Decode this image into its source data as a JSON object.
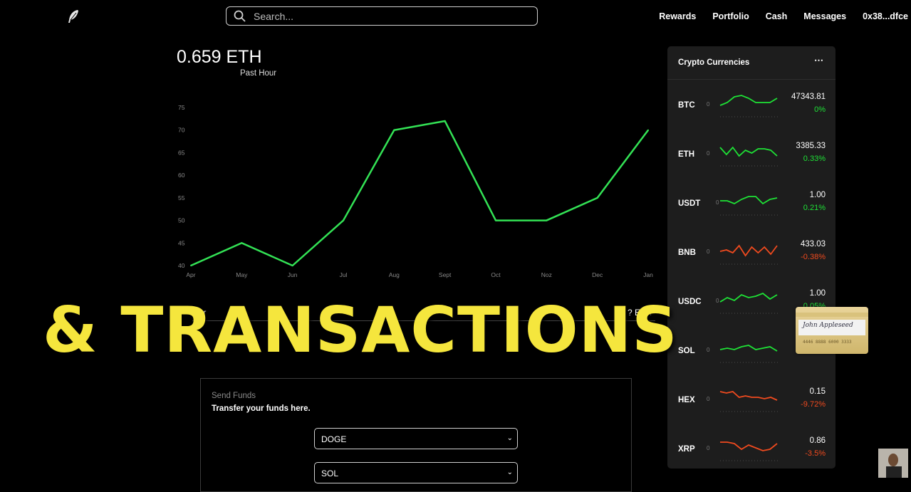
{
  "header": {
    "search_placeholder": "Search...",
    "nav": [
      "Rewards",
      "Portfolio",
      "Cash",
      "Messages",
      "0x38...dfce"
    ]
  },
  "balance": {
    "amount": "0.659 ETH",
    "period": "Past Hour"
  },
  "chart_data": {
    "type": "line",
    "categories": [
      "Apr",
      "May",
      "Jun",
      "Jul",
      "Aug",
      "Sept",
      "Oct",
      "Noz",
      "Dec",
      "Jan"
    ],
    "values": [
      40,
      45,
      40,
      50,
      70,
      72,
      50,
      50,
      55,
      70
    ],
    "yticks": [
      40,
      45,
      50,
      55,
      60,
      65,
      70,
      75
    ],
    "ylim": [
      40,
      75
    ],
    "color": "#33e255",
    "grid": false
  },
  "buy_row": {
    "left": "wer",
    "right": "? ETH"
  },
  "send_funds": {
    "title": "Send Funds",
    "subtitle": "Transfer your funds here.",
    "from_select": "DOGE",
    "to_select": "SOL"
  },
  "crypto_panel": {
    "title": "Crypto Currencies",
    "more": "⋯",
    "coins": [
      {
        "symbol": "BTC",
        "zero": "0",
        "price": "47343.81",
        "change": "0%",
        "color": "#1ee236",
        "trend": [
          4,
          6,
          10,
          11,
          9,
          6,
          6,
          6,
          9
        ]
      },
      {
        "symbol": "ETH",
        "zero": "0",
        "price": "3385.33",
        "change": "0.33%",
        "color": "#1ee236",
        "trend": [
          9,
          4,
          9,
          3,
          7,
          5,
          8,
          8,
          7,
          3
        ]
      },
      {
        "symbol": "USDT",
        "zero": "0",
        "price": "1.00",
        "change": "0.21%",
        "color": "#1ee236",
        "trend": [
          6,
          6,
          4,
          7,
          9,
          9,
          4,
          7,
          8
        ]
      },
      {
        "symbol": "BNB",
        "zero": "0",
        "price": "433.03",
        "change": "-0.38%",
        "color": "#f04a1e",
        "trend": [
          5,
          6,
          4,
          9,
          2,
          8,
          4,
          8,
          3,
          9
        ]
      },
      {
        "symbol": "USDC",
        "zero": "0",
        "price": "1.00",
        "change": "0.05%",
        "color": "#1ee236",
        "trend": [
          4,
          7,
          5,
          9,
          7,
          8,
          10,
          6,
          9
        ]
      },
      {
        "symbol": "SOL",
        "zero": "0",
        "price": "",
        "change": "",
        "color": "#1ee236",
        "trend": [
          5,
          6,
          5,
          7,
          8,
          5,
          6,
          7,
          4
        ]
      },
      {
        "symbol": "HEX",
        "zero": "0",
        "price": "0.15",
        "change": "-9.72%",
        "color": "#f04a1e",
        "trend": [
          10,
          9,
          10,
          6,
          7,
          6,
          6,
          5,
          6,
          4
        ]
      },
      {
        "symbol": "XRP",
        "zero": "0",
        "price": "0.86",
        "change": "-3.5%",
        "color": "#f04a1e",
        "trend": [
          9,
          9,
          8,
          4,
          7,
          5,
          3,
          4,
          8
        ]
      }
    ]
  },
  "overlay": {
    "text": "& TRANSACTIONS",
    "color": "#f5e63d"
  },
  "card": {
    "signature": "John Appleseed",
    "number": "4446 8888 6000 3333"
  },
  "colors": {
    "positive": "#1ee236",
    "negative": "#f04a1e"
  }
}
